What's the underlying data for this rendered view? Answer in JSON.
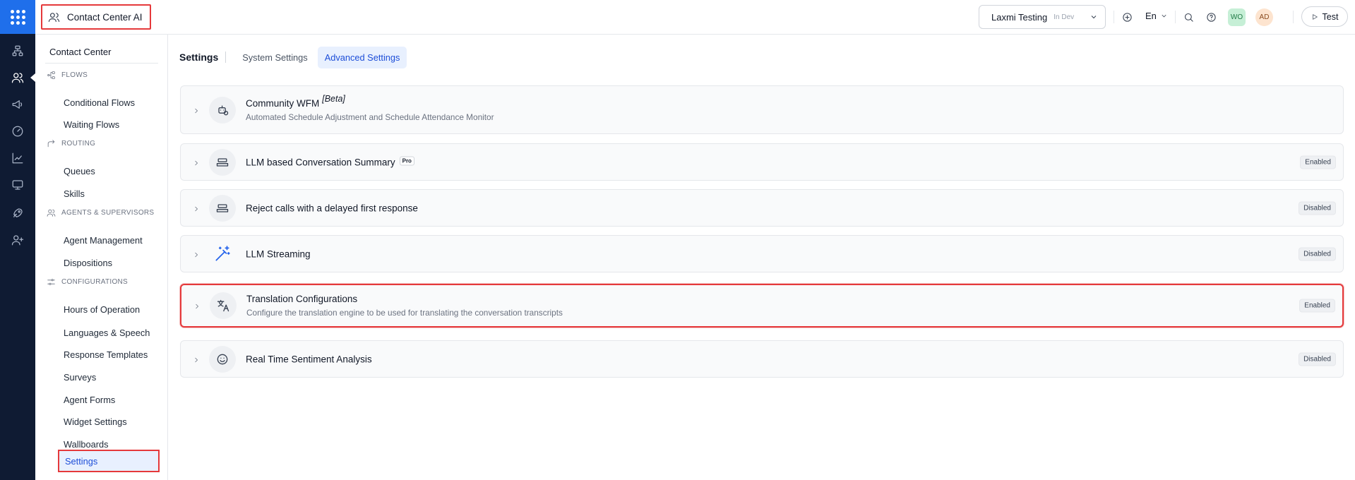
{
  "app": {
    "title": "Contact Center AI"
  },
  "header": {
    "environment": {
      "name": "Laxmi Testing",
      "tag": "In Dev"
    },
    "language": "En",
    "avatars": [
      "WO",
      "AD"
    ],
    "test_label": "Test"
  },
  "sidebar": {
    "title": "Contact Center",
    "sections": [
      {
        "label": "FLOWS",
        "items": [
          "Conditional Flows",
          "Waiting Flows"
        ]
      },
      {
        "label": "ROUTING",
        "items": [
          "Queues",
          "Skills"
        ]
      },
      {
        "label": "AGENTS & SUPERVISORS",
        "items": [
          "Agent Management",
          "Dispositions"
        ]
      },
      {
        "label": "CONFIGURATIONS",
        "items": [
          "Hours of Operation",
          "Languages & Speech",
          "Response Templates",
          "Surveys",
          "Agent Forms",
          "Widget Settings",
          "Wallboards",
          "Settings"
        ]
      }
    ],
    "active_item": "Settings"
  },
  "main": {
    "page_title": "Settings",
    "tabs": [
      "System Settings",
      "Advanced Settings"
    ],
    "active_tab": "Advanced Settings",
    "cards": [
      {
        "title": "Community WFM",
        "title_tag": "[Beta]",
        "description": "Automated Schedule Adjustment and Schedule Attendance Monitor",
        "status": "",
        "icon": "robot-gear-icon"
      },
      {
        "title": "LLM based Conversation Summary",
        "pro_badge": "Pro",
        "description": "",
        "status": "Enabled",
        "icon": "tray-icon"
      },
      {
        "title": "Reject calls with a delayed first response",
        "description": "",
        "status": "Disabled",
        "icon": "tray-icon"
      },
      {
        "title": "LLM Streaming",
        "description": "",
        "status": "Disabled",
        "icon": "magic-wand-icon"
      },
      {
        "title": "Translation Configurations",
        "description": "Configure the translation engine to be used for translating the conversation transcripts",
        "status": "Enabled",
        "icon": "translate-icon"
      },
      {
        "title": "Real Time Sentiment Analysis",
        "description": "",
        "status": "Disabled",
        "icon": "smiley-icon"
      }
    ]
  },
  "colors": {
    "rail": "#0f1b33",
    "accent": "#1d4ed8",
    "highlight": "#e5393b"
  }
}
